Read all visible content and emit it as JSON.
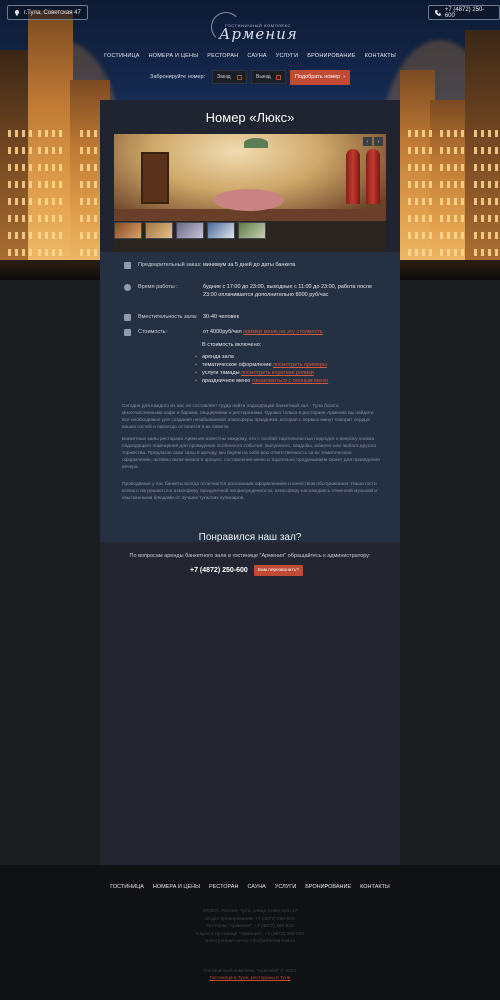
{
  "header": {
    "address": "г.Тула, Советская 47",
    "phone": "+7 (4872) 250-600",
    "logo_sub": "гостиничный комплекс",
    "logo_name": "Армения"
  },
  "nav": [
    "Гостиница",
    "Номера и цены",
    "Ресторан",
    "Сауна",
    "Услуги",
    "Бронирование",
    "Контакты"
  ],
  "booking": {
    "label": "Забронируйте номер:",
    "checkin": "Заезд",
    "checkout": "Выезд",
    "button": "Подобрать номер"
  },
  "page": {
    "title": "Номер «Люкс»"
  },
  "gallery": {
    "prev": "‹",
    "next": "›"
  },
  "info": {
    "preorder_label": "Предварительный заказ:",
    "preorder_value": "минимум за 5 дней до даты банкета",
    "hours_label": "Время работы :",
    "hours_value": "будние с 17:00 до 23:00, выходные с 11:00 до 23:00, работа после 23:00 оплачивается дополнительно 8000 руб/час",
    "capacity_label": "Вместительность зала:",
    "capacity_value": "30-40 человек",
    "price_label": "Стоимость:",
    "price_value": "от 4000руб/чел",
    "price_link": "пример меню на эту стоимость",
    "included_title": "В стоимость включено:",
    "items": [
      {
        "text": "аренда зала",
        "link": ""
      },
      {
        "text": "тематическое оформление",
        "link": "посмотреть примеры"
      },
      {
        "text": "услуги тамады",
        "link": "посмотреть короткие ролики"
      },
      {
        "text": "праздничное меню",
        "link": "ознакомиться с полным меню"
      }
    ]
  },
  "description": [
    "Сегодня для каждого из нас не составляет труда найти подходящий банкетный зал - Тула богата многочисленными кафе и барами, пиццериями и ресторанами. Однако только в ресторане Армения вы найдете все необходимое для создания незабываемой атмосферы праздника, которая с первых минут покорит сердца ваших гостей и навсегда останется в их памяти.",
    "Банкетные залы ресторана Армения известны каждому, кто с особой тщательностью подходит к вопросу поиска подходящего помещения для проведения особенного события: выпускного, свадьбы, юбилея или любого другого торжества. Предлагая свои залы в аренду, мы берем на себя всю ответственность за их тематическое оформление, активно включаемся в процесс составления меню и тщательно продумываем сюжет для проведения вечера.",
    "Проводимые у нас банкеты всегда отличаются роскошным оформлением и качеством обслуживания. Наши гости всякого погружаются в атмосферу праздничной непринужденности, атмосферу наслаждаясь отменной музыкой и изысканными блюдами от лучших тульских кулинаров."
  ],
  "cta": {
    "title": "Понравился наш зал?",
    "text": "По вопросам аренды банкетного зала в гостинице \"Армения\" обращайтесь к администратору:",
    "phone": "+7 (4872) 250-600",
    "callback": "Вам перезвонить?"
  },
  "footer": {
    "nav": [
      "Гостиница",
      "Номера и цены",
      "Ресторан",
      "Сауна",
      "Услуги",
      "Бронирование",
      "Контакты"
    ],
    "address_lines": [
      "300000, Россия, Тула, улица Советская 47",
      "Отдел бронирования: +7 (4872) 250-600",
      "Ресторан \"Армения\": +7 (4872) 250-612",
      "Сауна в гостинице \"Армения\": +7 (4872) 250-600",
      "Электронная почта: info@armenia-tula.ru"
    ],
    "copyright": "Гостиничный комплекс \"Армения\" © 2024",
    "seo_link": "Гостиница в Туле, рестораны в Туле"
  }
}
